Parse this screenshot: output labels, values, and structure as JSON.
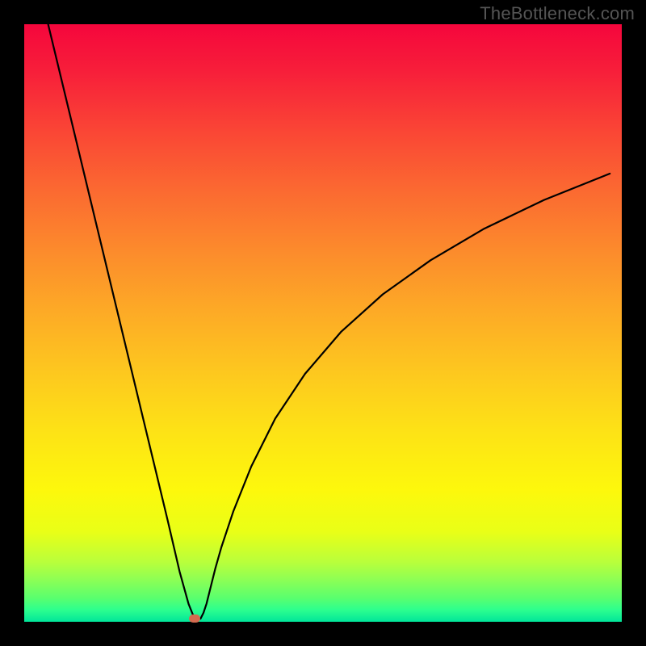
{
  "watermark": "TheBottleneck.com",
  "chart_data": {
    "type": "line",
    "title": "",
    "xlabel": "",
    "ylabel": "",
    "xlim": [
      0,
      100
    ],
    "ylim": [
      0,
      100
    ],
    "grid": false,
    "legend": false,
    "series": [
      {
        "name": "curve",
        "x": [
          4,
          6,
          8,
          10,
          12,
          14,
          16,
          18,
          20,
          22,
          24,
          26,
          27.5,
          28.5,
          29.5,
          30,
          30.5,
          31,
          32,
          33,
          35,
          38,
          42,
          47,
          53,
          60,
          68,
          77,
          87,
          98
        ],
        "y": [
          100,
          91.7,
          83.4,
          75.1,
          66.8,
          58.5,
          50.2,
          41.9,
          33.6,
          25.3,
          17.0,
          8.4,
          3.0,
          0.5,
          0.5,
          1.5,
          3.0,
          5.0,
          9.0,
          12.5,
          18.5,
          26.0,
          34.0,
          41.5,
          48.5,
          54.8,
          60.5,
          65.8,
          70.6,
          75.0
        ]
      }
    ],
    "marker": {
      "x": 28.5,
      "y": 0.5,
      "color": "#d46a4f"
    },
    "background_gradient": {
      "direction": "vertical",
      "stops": [
        {
          "pos": 0.0,
          "color": "#f5063c"
        },
        {
          "pos": 0.5,
          "color": "#fdaa26"
        },
        {
          "pos": 0.8,
          "color": "#fdf80c"
        },
        {
          "pos": 1.0,
          "color": "#00e59a"
        }
      ]
    }
  }
}
